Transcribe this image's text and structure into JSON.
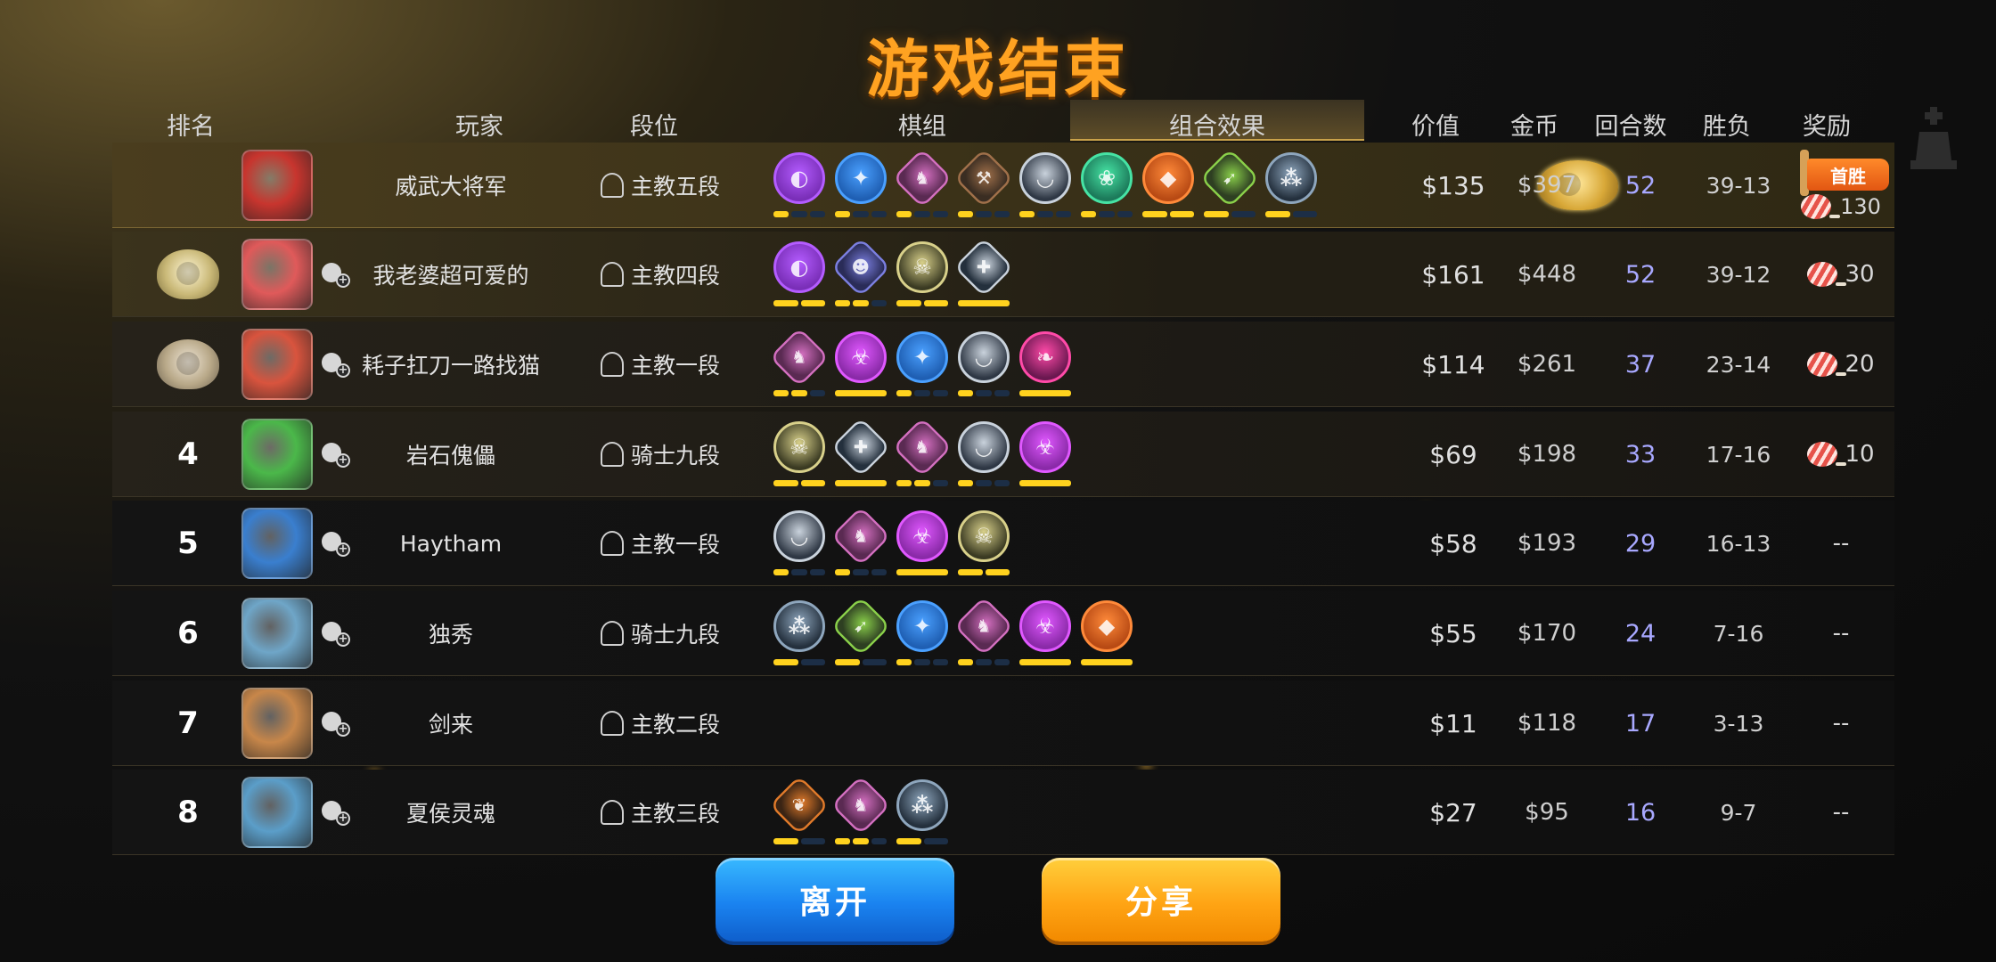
{
  "title": "游戏结束",
  "headers": {
    "rank": "排名",
    "player": "玩家",
    "tier": "段位",
    "synergy": "棋组",
    "combo_tab": "组合效果",
    "value": "价值",
    "gold": "金币",
    "rounds": "回合数",
    "win_loss": "胜负",
    "reward": "奖励"
  },
  "first_win_label": "首胜",
  "rows": [
    {
      "rank": "",
      "medal": "gold",
      "avatar_color": "#c8352e",
      "name": "威武大将军",
      "tier": "主教五段",
      "value": "$135",
      "gold": "$397",
      "rounds": "52",
      "wl": "39-13",
      "reward": "130",
      "first_win": true,
      "synergies": [
        {
          "color": "#7a2fb8",
          "ring": "#b45cff",
          "glyph": "◐",
          "bars": [
            1,
            0,
            0
          ]
        },
        {
          "color": "#1f5fb3",
          "ring": "#4aa0ff",
          "glyph": "✦",
          "bars": [
            1,
            0,
            0
          ]
        },
        {
          "color": "#5a2a52",
          "ring": "#d36fc0",
          "glyph": "♞",
          "bars": [
            1,
            0,
            0
          ]
        },
        {
          "color": "#3a2d22",
          "ring": "#a0704a",
          "glyph": "⚒",
          "bars": [
            1,
            0,
            0
          ]
        },
        {
          "color": "#2e3744",
          "ring": "#c9d2dc",
          "glyph": "◡",
          "bars": [
            1,
            0,
            0
          ]
        },
        {
          "color": "#1c7a5a",
          "ring": "#46e3a4",
          "glyph": "❀",
          "bars": [
            1,
            0,
            0
          ]
        },
        {
          "color": "#b84a14",
          "ring": "#ff8a3a",
          "glyph": "◆",
          "bars": [
            1,
            1
          ]
        },
        {
          "color": "#2e3f22",
          "ring": "#8ad04a",
          "glyph": "➹",
          "bars": [
            1,
            0
          ]
        },
        {
          "color": "#24303d",
          "ring": "#8ea6bd",
          "glyph": "⁂",
          "bars": [
            1,
            0
          ]
        }
      ]
    },
    {
      "rank": "",
      "medal": "silver",
      "avatar_color": "#e05a5a",
      "name": "我老婆超可爱的",
      "tier": "主教四段",
      "value": "$161",
      "gold": "$448",
      "rounds": "52",
      "wl": "39-12",
      "reward": "30",
      "first_win": false,
      "synergies": [
        {
          "color": "#7a2fb8",
          "ring": "#b45cff",
          "glyph": "◐",
          "bars": [
            1,
            1
          ]
        },
        {
          "color": "#2a2c58",
          "ring": "#7b7fe0",
          "glyph": "☻",
          "bars": [
            1,
            1,
            0
          ]
        },
        {
          "color": "#3a3a22",
          "ring": "#d8d08a",
          "glyph": "☠",
          "bars": [
            1,
            1
          ]
        },
        {
          "color": "#24303d",
          "ring": "#c9d2dc",
          "glyph": "✚",
          "bars": [
            1
          ]
        }
      ]
    },
    {
      "rank": "",
      "medal": "bronze",
      "avatar_color": "#d9543e",
      "name": "耗子扛刀一路找猫",
      "tier": "主教一段",
      "value": "$114",
      "gold": "$261",
      "rounds": "37",
      "wl": "23-14",
      "reward": "20",
      "first_win": false,
      "synergies": [
        {
          "color": "#5a2a52",
          "ring": "#d36fc0",
          "glyph": "♞",
          "bars": [
            1,
            1,
            0
          ]
        },
        {
          "color": "#8a2aa8",
          "ring": "#e058ff",
          "glyph": "☣",
          "bars": [
            1
          ]
        },
        {
          "color": "#1f5fb3",
          "ring": "#4aa0ff",
          "glyph": "✦",
          "bars": [
            1,
            0,
            0
          ]
        },
        {
          "color": "#2e3744",
          "ring": "#c9d2dc",
          "glyph": "◡",
          "bars": [
            1,
            0,
            0
          ]
        },
        {
          "color": "#6a1850",
          "ring": "#ff4aa8",
          "glyph": "❧",
          "bars": [
            1
          ]
        }
      ]
    },
    {
      "rank": "4",
      "medal": "",
      "avatar_color": "#4bb84a",
      "name": "岩石傀儡",
      "tier": "骑士九段",
      "value": "$69",
      "gold": "$198",
      "rounds": "33",
      "wl": "17-16",
      "reward": "10",
      "first_win": false,
      "synergies": [
        {
          "color": "#3a3a22",
          "ring": "#d8d08a",
          "glyph": "☠",
          "bars": [
            1,
            1
          ]
        },
        {
          "color": "#24303d",
          "ring": "#c9d2dc",
          "glyph": "✚",
          "bars": [
            1
          ]
        },
        {
          "color": "#5a2a52",
          "ring": "#d36fc0",
          "glyph": "♞",
          "bars": [
            1,
            1,
            0
          ]
        },
        {
          "color": "#2e3744",
          "ring": "#c9d2dc",
          "glyph": "◡",
          "bars": [
            1,
            0,
            0
          ]
        },
        {
          "color": "#8a2aa8",
          "ring": "#e058ff",
          "glyph": "☣",
          "bars": [
            1
          ]
        }
      ]
    },
    {
      "rank": "5",
      "medal": "",
      "avatar_color": "#3a7fcf",
      "name": "Haytham",
      "tier": "主教一段",
      "value": "$58",
      "gold": "$193",
      "rounds": "29",
      "wl": "16-13",
      "reward": "--",
      "first_win": false,
      "synergies": [
        {
          "color": "#2e3744",
          "ring": "#c9d2dc",
          "glyph": "◡",
          "bars": [
            1,
            0,
            0
          ]
        },
        {
          "color": "#5a2a52",
          "ring": "#d36fc0",
          "glyph": "♞",
          "bars": [
            1,
            0,
            0
          ]
        },
        {
          "color": "#8a2aa8",
          "ring": "#e058ff",
          "glyph": "☣",
          "bars": [
            1
          ]
        },
        {
          "color": "#3a3a22",
          "ring": "#d8d08a",
          "glyph": "☠",
          "bars": [
            1,
            1
          ]
        }
      ]
    },
    {
      "rank": "6",
      "medal": "",
      "avatar_color": "#6fa6c8",
      "name": "独秀",
      "tier": "骑士九段",
      "value": "$55",
      "gold": "$170",
      "rounds": "24",
      "wl": "7-16",
      "reward": "--",
      "first_win": false,
      "synergies": [
        {
          "color": "#24303d",
          "ring": "#8ea6bd",
          "glyph": "⁂",
          "bars": [
            1,
            0
          ]
        },
        {
          "color": "#2e3f22",
          "ring": "#8ad04a",
          "glyph": "➹",
          "bars": [
            1,
            0
          ]
        },
        {
          "color": "#1f5fb3",
          "ring": "#4aa0ff",
          "glyph": "✦",
          "bars": [
            1,
            0,
            0
          ]
        },
        {
          "color": "#5a2a52",
          "ring": "#d36fc0",
          "glyph": "♞",
          "bars": [
            1,
            0,
            0
          ]
        },
        {
          "color": "#8a2aa8",
          "ring": "#e058ff",
          "glyph": "☣",
          "bars": [
            1
          ]
        },
        {
          "color": "#b84a14",
          "ring": "#ff8a3a",
          "glyph": "◆",
          "bars": [
            1
          ]
        }
      ]
    },
    {
      "rank": "7",
      "medal": "",
      "avatar_color": "#c8874a",
      "name": "剑来",
      "tier": "主教二段",
      "value": "$11",
      "gold": "$118",
      "rounds": "17",
      "wl": "3-13",
      "reward": "--",
      "first_win": false,
      "synergies": []
    },
    {
      "rank": "8",
      "medal": "",
      "avatar_color": "#5b9ec9",
      "name": "夏侯灵魂",
      "tier": "主教三段",
      "value": "$27",
      "gold": "$95",
      "rounds": "16",
      "wl": "9-7",
      "reward": "--",
      "first_win": false,
      "synergies": [
        {
          "color": "#3a2414",
          "ring": "#e07a2a",
          "glyph": "❦",
          "bars": [
            1,
            0
          ]
        },
        {
          "color": "#5a2a52",
          "ring": "#d36fc0",
          "glyph": "♞",
          "bars": [
            1,
            1,
            0
          ]
        },
        {
          "color": "#24303d",
          "ring": "#8ea6bd",
          "glyph": "⁂",
          "bars": [
            1,
            0
          ]
        }
      ]
    }
  ],
  "buttons": {
    "leave": "离开",
    "share": "分享"
  }
}
